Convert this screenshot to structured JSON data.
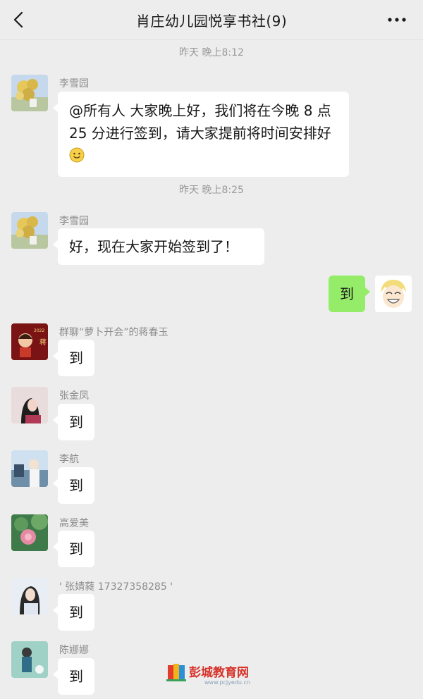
{
  "header": {
    "title": "肖庄幼儿园悦享书社(9)"
  },
  "timestamps": [
    "昨天 晚上8:12",
    "昨天 晚上8:25"
  ],
  "messages": [
    {
      "sender": "李雪园",
      "text": "@所有人 大家晚上好，我们将在今晚 8 点 25 分进行签到，请大家提前将时间安排好",
      "emoji": "smile-emoji"
    },
    {
      "sender": "李雪园",
      "text": "好，现在大家开始签到了！"
    },
    {
      "sender": "",
      "text": "到",
      "mine": true
    },
    {
      "sender": "群聊“萝卜开会”的蒋春玉",
      "text": "到"
    },
    {
      "sender": "张金凤",
      "text": "到"
    },
    {
      "sender": "李航",
      "text": "到"
    },
    {
      "sender": "高爱美",
      "text": "到"
    },
    {
      "sender": "' 张婧蕤 17327358285 '",
      "text": "到"
    },
    {
      "sender": "陈娜娜",
      "text": "到"
    }
  ],
  "watermark": {
    "name": "彭城教育网",
    "url": "www.pcjyedu.cn"
  },
  "icons": {
    "back": "chevron-left-icon",
    "more": "more-dots-icon"
  }
}
